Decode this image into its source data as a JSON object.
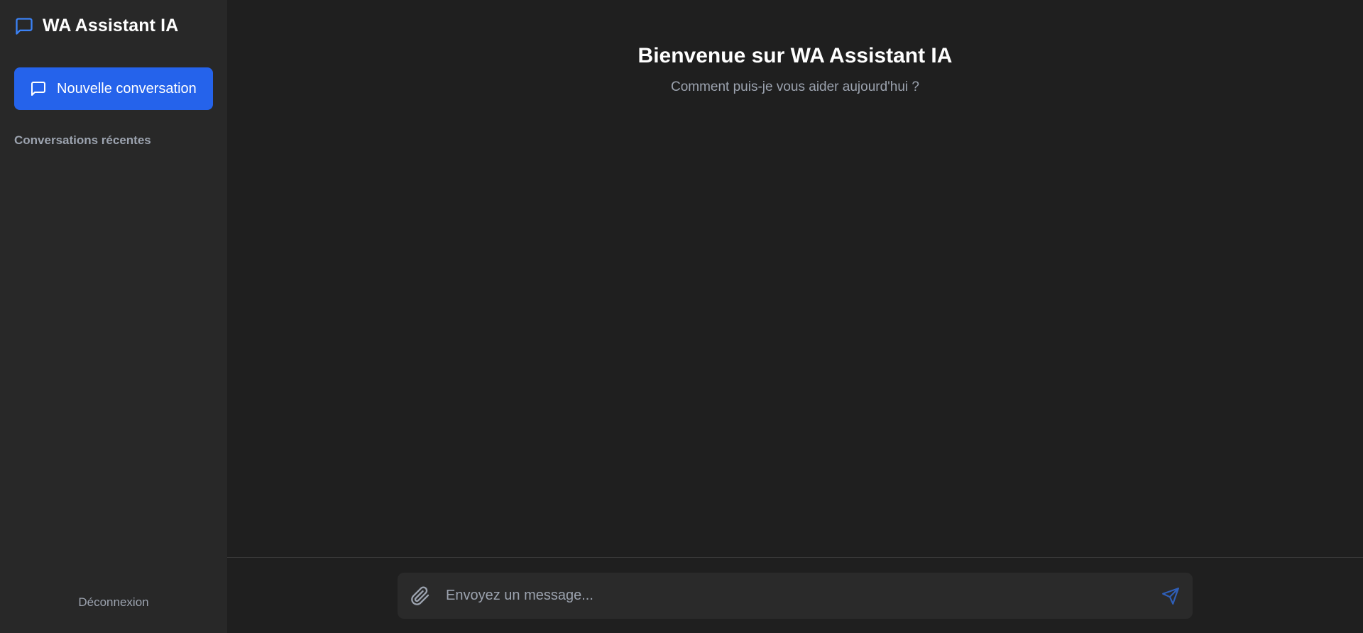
{
  "sidebar": {
    "brand": {
      "title": "WA Assistant IA",
      "icon": "chat-bubble-icon"
    },
    "new_chat": {
      "label": "Nouvelle conversation",
      "icon": "chat-bubble-icon"
    },
    "recent_heading": "Conversations récentes",
    "logout_label": "Déconnexion"
  },
  "main": {
    "welcome_title": "Bienvenue sur WA Assistant IA",
    "welcome_subtitle": "Comment puis-je vous aider aujourd'hui ?"
  },
  "composer": {
    "placeholder": "Envoyez un message...",
    "attach_icon": "paperclip-icon",
    "send_icon": "send-icon"
  },
  "colors": {
    "accent": "#2563eb",
    "sidebar_bg": "#282828",
    "main_bg": "#1f1f1f",
    "muted_text": "#9ca3af"
  }
}
